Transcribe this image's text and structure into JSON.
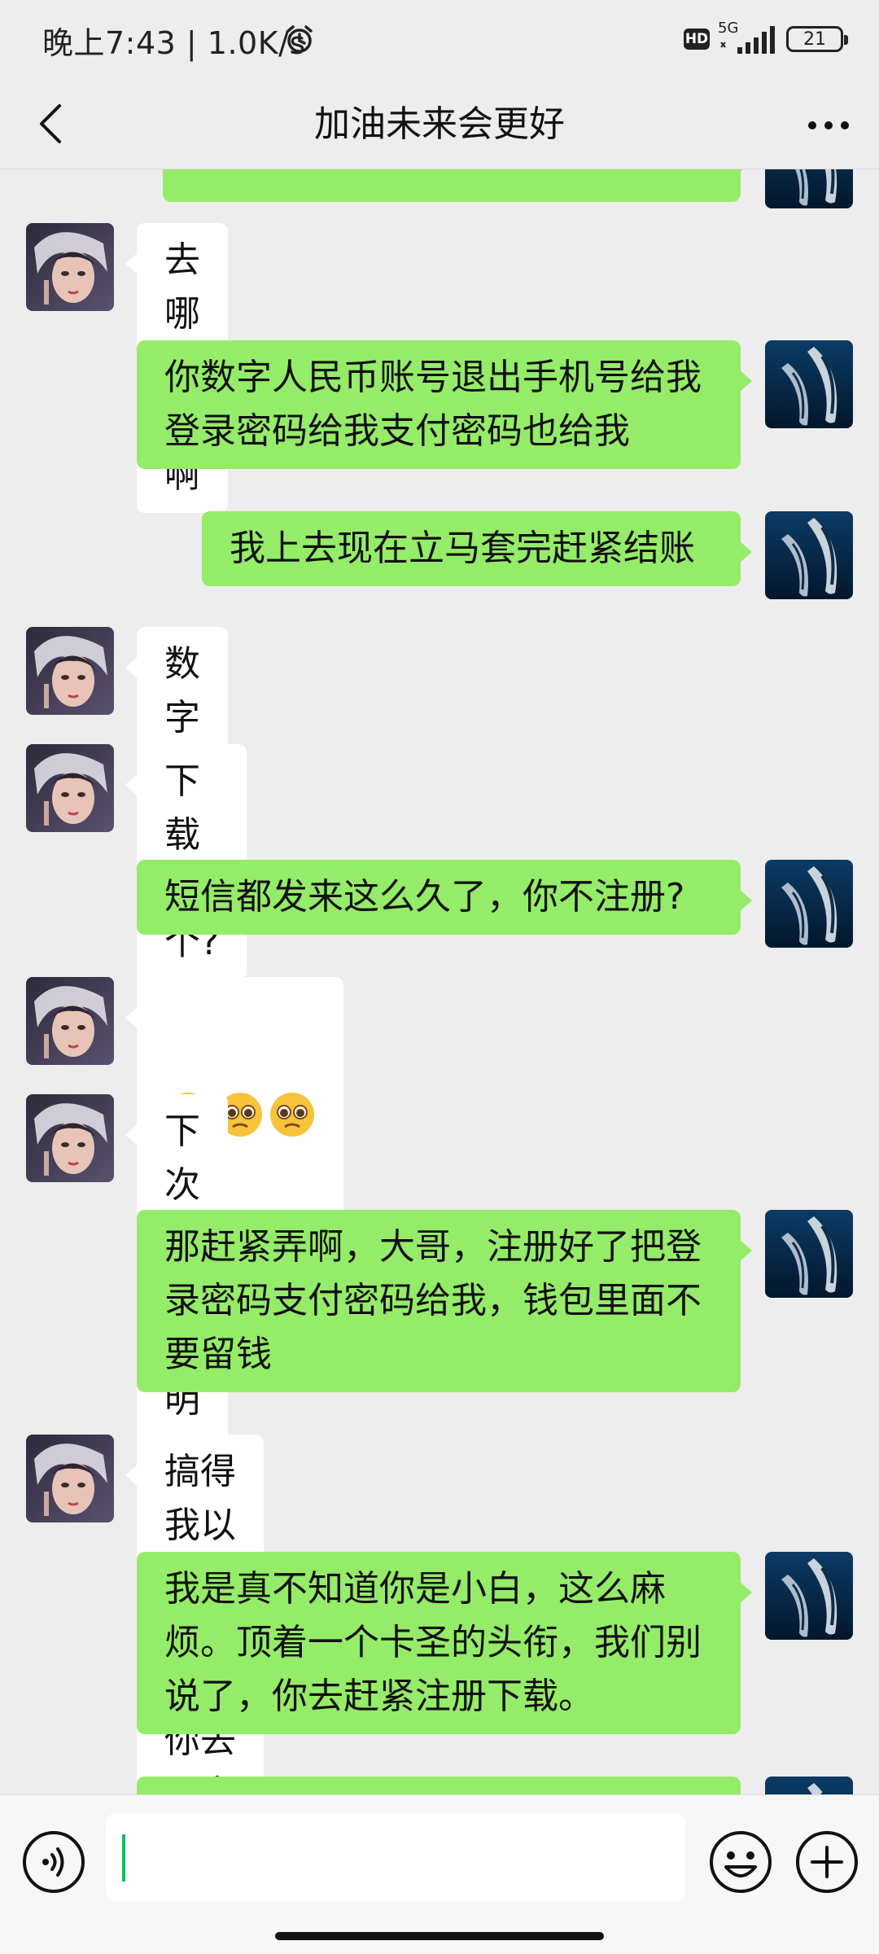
{
  "status_bar": {
    "time_speed": "晚上7:43 | 1.0K/s",
    "hd_label": "HD",
    "network_label": "5G",
    "battery_level": "21"
  },
  "header": {
    "title": "加油未来会更好",
    "back_icon": "chevron-left-icon",
    "more_icon": "ellipsis-icon"
  },
  "messages": [
    {
      "sender": "self",
      "text": ""
    },
    {
      "sender": "contact",
      "text": "去哪里看啊"
    },
    {
      "sender": "self",
      "text": "你数字人民币账号退出手机号给我\n登录密码给我支付密码也给我"
    },
    {
      "sender": "self",
      "text": "我上去现在立马套完赶紧结账"
    },
    {
      "sender": "contact",
      "text": "数字人民币我没注册啊"
    },
    {
      "sender": "contact",
      "text": "下载一个?"
    },
    {
      "sender": "self",
      "text": "短信都发来这么久了，你不注册?"
    },
    {
      "sender": "contact",
      "emoji": [
        "🥺",
        "🥺",
        "🥺"
      ]
    },
    {
      "sender": "contact",
      "text": "下次发帖说明白点"
    },
    {
      "sender": "self",
      "text": "那赶紧弄啊，大哥，注册好了把登\n录密码支付密码给我，钱包里面不\n要留钱"
    },
    {
      "sender": "contact",
      "text": "搞得我以为给你号码，你去弄完"
    },
    {
      "sender": "self",
      "text": "我是真不知道你是小白，这么麻\n烦。顶着一个卡圣的头衔，我们别\n说了，你去赶紧注册下载。"
    },
    {
      "sender": "self",
      "text": ""
    }
  ],
  "input_bar": {
    "voice_icon": "voice-icon",
    "emoji_icon": "smiley-icon",
    "plus_icon": "plus-icon",
    "input_value": ""
  },
  "colors": {
    "background": "#ededed",
    "sent_bubble": "#95ec69",
    "received_bubble": "#ffffff",
    "caret": "#07c160"
  }
}
